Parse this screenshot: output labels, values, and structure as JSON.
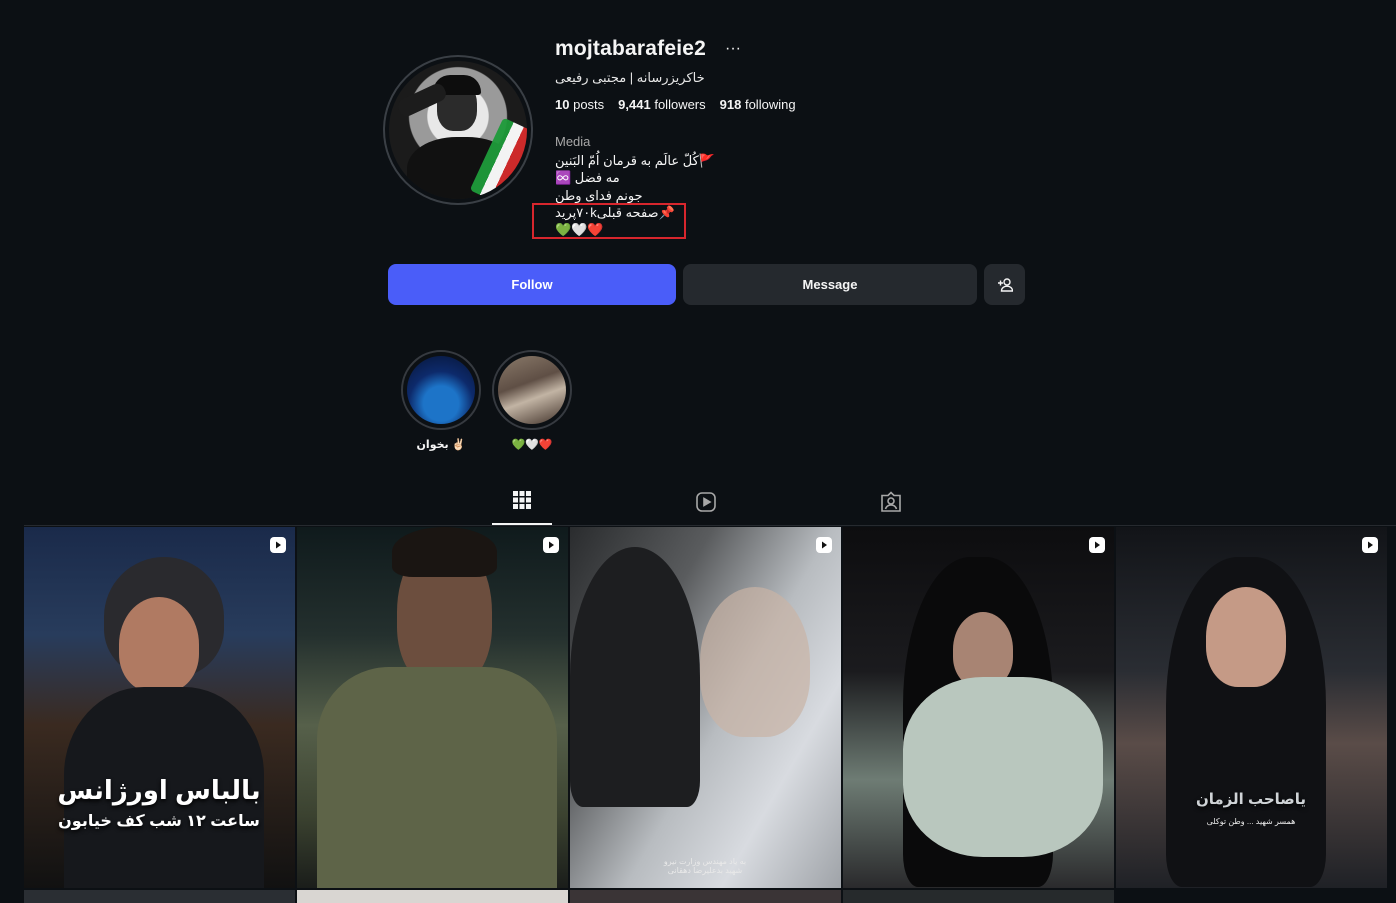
{
  "profile": {
    "username": "mojtabarafeie2",
    "more_glyph": "···",
    "full_name": "خاکریزرسانه | مجتبی رفیعی",
    "stats": {
      "posts_count": "10",
      "posts_label": "posts",
      "followers_count": "9,441",
      "followers_label": "followers",
      "following_count": "918",
      "following_label": "following"
    },
    "category": "Media",
    "bio_lines": [
      "🚩كُلّ عالَم به قرمان اُمّ البَنین",
      "مه فضل ♾️",
      "جونم فدای وطن",
      "📌صفحه قبلی۷۰kپرید",
      "💚🤍❤️"
    ]
  },
  "actions": {
    "follow_label": "Follow",
    "message_label": "Message"
  },
  "highlights": [
    {
      "label": "بخوان ✌🏻"
    },
    {
      "label": "💚🤍❤️"
    }
  ],
  "tabs": [
    {
      "name": "posts",
      "icon": "grid-icon",
      "active": true
    },
    {
      "name": "reels",
      "icon": "reels-icon",
      "active": false
    },
    {
      "name": "tagged",
      "icon": "tagged-icon",
      "active": false
    }
  ],
  "grid": [
    {
      "type": "reel",
      "caption_main": "بالباس اورژانس",
      "caption_sub": "ساعت ۱۲ شب کف خیابون"
    },
    {
      "type": "reel"
    },
    {
      "type": "reel",
      "caption_small": "به یاد مهندس وزارت نیرو\nشهید بدعلیرضا دهقانی"
    },
    {
      "type": "reel"
    },
    {
      "type": "reel",
      "caption_main": "یاصاحب الزمان",
      "caption_small": "همسر شهید ... وطن توکلی"
    }
  ],
  "colors": {
    "background": "#0c1014",
    "follow_button": "#4a5df9",
    "secondary_button": "#25292e",
    "highlight_box": "#d8262d"
  }
}
